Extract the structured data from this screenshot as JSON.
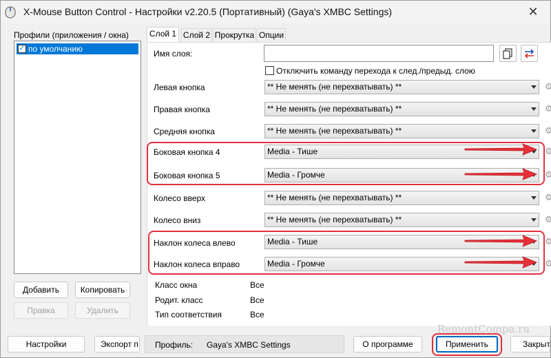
{
  "window": {
    "title": "X-Mouse Button Control - Настройки v2.20.5 (Портативный) (Gaya's XMBC Settings)"
  },
  "profiles": {
    "label": "Профили (приложения / окна)",
    "items": [
      {
        "label": "по умолчанию",
        "checked": true
      }
    ],
    "buttons": {
      "add": "Добавить",
      "copy": "Копировать",
      "edit": "Правка",
      "delete": "Удалить"
    }
  },
  "tabs": [
    {
      "label": "Слой 1",
      "active": true
    },
    {
      "label": "Слой 2",
      "active": false
    },
    {
      "label": "Прокрутка",
      "active": false
    },
    {
      "label": "Опции",
      "active": false
    }
  ],
  "layer": {
    "name_label": "Имя слоя:",
    "name_value": "",
    "disable_nav_label": "Отключить команду перехода к след./предыд. слою",
    "disable_nav_checked": false,
    "rows": [
      {
        "label": "Левая кнопка",
        "value": "** Не менять (не перехватывать) **"
      },
      {
        "label": "Правая кнопка",
        "value": "** Не менять (не перехватывать) **"
      },
      {
        "label": "Средняя кнопка",
        "value": "** Не менять (не перехватывать) **"
      },
      {
        "label": "Боковая кнопка 4",
        "value": "Media - Тише"
      },
      {
        "label": "Боковая кнопка 5",
        "value": "Media - Громче"
      },
      {
        "label": "Колесо вверх",
        "value": "** Не менять (не перехватывать) **"
      },
      {
        "label": "Колесо вниз",
        "value": "** Не менять (не перехватывать) **"
      },
      {
        "label": "Наклон колеса влево",
        "value": "Media - Тише"
      },
      {
        "label": "Наклон колеса вправо",
        "value": "Media - Громче"
      }
    ]
  },
  "info": [
    {
      "label": "Класс окна",
      "value": "Все"
    },
    {
      "label": "Родит. класс",
      "value": "Все"
    },
    {
      "label": "Тип соответствия",
      "value": "Все"
    }
  ],
  "bottom": {
    "settings": "Настройки",
    "export": "Экспорт п",
    "profile_label": "Профиль:",
    "profile_value": "Gaya's XMBC Settings",
    "about": "О программе",
    "apply": "Применить",
    "close": "Закрыт"
  },
  "watermark": "RemontCompa.ru",
  "colors": {
    "highlight": "#e0303e",
    "selection": "#0078d7"
  }
}
